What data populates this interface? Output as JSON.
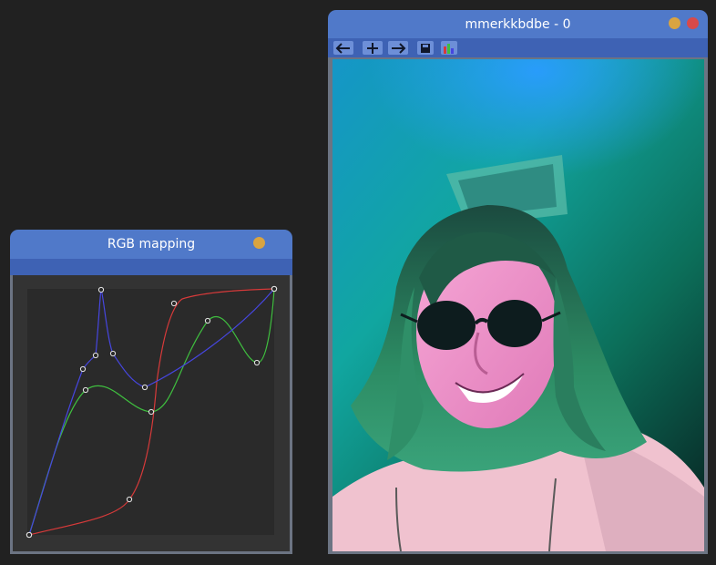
{
  "curves_window": {
    "title": "RGB mapping",
    "curves": [
      {
        "channel": "red",
        "color": "#d83a3a"
      },
      {
        "channel": "green",
        "color": "#3fbf3f"
      },
      {
        "channel": "blue",
        "color": "#4646e0"
      }
    ]
  },
  "viewer_window": {
    "title": "mmerkkbdbe - 0",
    "toolbar": [
      {
        "name": "back-button",
        "icon": "arrow-left-icon"
      },
      {
        "name": "add-button",
        "icon": "plus-icon"
      },
      {
        "name": "forward-button",
        "icon": "arrow-right-icon"
      },
      {
        "name": "save-button",
        "icon": "disk-icon"
      },
      {
        "name": "histogram-button",
        "icon": "histogram-icon"
      }
    ],
    "photo": {
      "subject": "selfie"
    }
  },
  "colors": {
    "background": "#212121",
    "titlebar": "#5079c9",
    "toolbar": "#3e62b4",
    "minimize": "#d9a441",
    "close": "#d84a4a"
  }
}
